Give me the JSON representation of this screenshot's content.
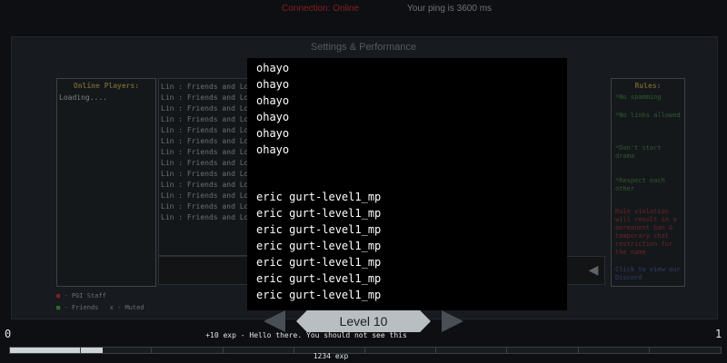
{
  "topbar": {
    "connection": "Connection: Online",
    "ping": "Your ping is 3600 ms"
  },
  "background": {
    "settings_title": "Settings & Performance",
    "players": {
      "title": "Online Players:",
      "loading": "Loading...."
    },
    "chat_lines": [
      "Lin : Friends and Lobby Chat feature! Spring sale :)",
      "Lin : Friends and Lobby Chat feature! Spring sale :)",
      "Lin : Friends and Lobby Chat feature! Spring sale :)",
      "Lin : Friends and Lobby Chat feature! Spring sale :)",
      "Lin : Friends and Lobby Chat feature! Spring sale :)",
      "Lin : Friends and Lobby Chat feature! Spring sale :)",
      "Lin : Friends and Lobby Chat feature! Spring sale :)",
      "Lin : Friends and Lobby Chat feature! Spring sale :)",
      "Lin : Friends and Lobby Chat feature! Spring sale :)",
      "Lin : Friends and Lobby Chat feature! Spring sale :)",
      "Lin : Friends and Lobby Chat feature! Spring sale :)",
      "Lin : Friends and Lobby Chat feature! Spring sale :)",
      "Lin : Friends and Lobby Chat feature! Spring sale :)"
    ],
    "rules": {
      "title": "Rules:",
      "items": [
        "*No spamming",
        "*No links allowed",
        "*Don't start drama",
        "*Respect each other"
      ],
      "warning": "Rule violation will result in a permanent ban & temporary chat restriction for the name",
      "history": "Click to view our Discord"
    },
    "legend": {
      "staff": "- PGI Staff",
      "friends": "- Friends",
      "muted": "x - Muted"
    }
  },
  "popup": {
    "lines_a": [
      "ohayo",
      "ohayo",
      "ohayo",
      "ohayo",
      "ohayo",
      "ohayo"
    ],
    "lines_b": [
      "eric gurt-level1_mp",
      "eric gurt-level1_mp",
      "eric gurt-level1_mp",
      "eric gurt-level1_mp",
      "eric gurt-level1_mp",
      "eric gurt-level1_mp",
      "eric gurt-level1_mp"
    ]
  },
  "level_selector": {
    "label": "Level 10",
    "prev_icon": "chevron-left-icon",
    "next_icon": "chevron-right-icon"
  },
  "exp_message": "+10 exp - Hello there. You should not see this",
  "xp": {
    "level_left": "0",
    "level_right": "1",
    "amount_text": "1234 exp",
    "progress_fraction": 0.13
  }
}
